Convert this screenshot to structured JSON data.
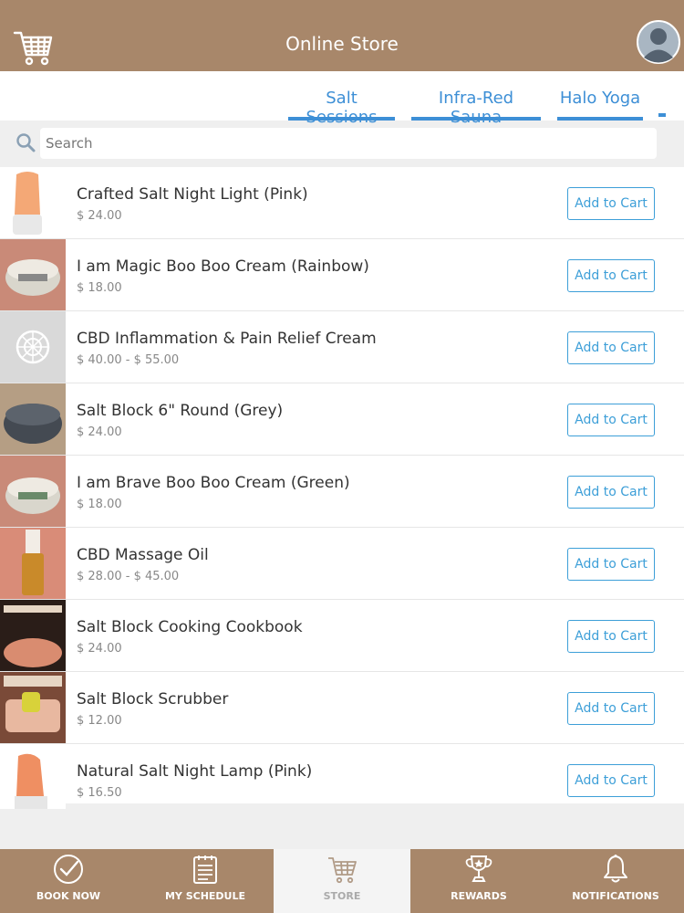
{
  "header": {
    "title": "Online Store",
    "cart_icon": "shopping-cart-icon",
    "avatar_icon": "user-avatar-icon"
  },
  "tabs": [
    {
      "label": "Salt Sessions"
    },
    {
      "label": "Infra-Red Sauna"
    },
    {
      "label": "Halo Yoga"
    }
  ],
  "search": {
    "placeholder": "Search",
    "icon": "search-icon"
  },
  "add_label": "Add to Cart",
  "products": [
    {
      "name": "Crafted Salt Night Light (Pink)",
      "price": "$ 24.00"
    },
    {
      "name": "I am Magic Boo Boo Cream (Rainbow)",
      "price": "$ 18.00"
    },
    {
      "name": "CBD Inflammation & Pain Relief Cream",
      "price": "$ 40.00 - $ 55.00"
    },
    {
      "name": "Salt Block 6\" Round (Grey)",
      "price": "$ 24.00"
    },
    {
      "name": "I am Brave Boo Boo Cream (Green)",
      "price": "$ 18.00"
    },
    {
      "name": "CBD Massage Oil",
      "price": "$ 28.00 - $ 45.00"
    },
    {
      "name": "Salt Block Cooking Cookbook",
      "price": "$ 24.00"
    },
    {
      "name": "Salt Block Scrubber",
      "price": "$ 12.00"
    },
    {
      "name": "Natural Salt Night Lamp (Pink)",
      "price": "$ 16.50"
    }
  ],
  "nav": [
    {
      "label": "BOOK NOW",
      "icon": "check-circle-icon"
    },
    {
      "label": "MY SCHEDULE",
      "icon": "calendar-icon"
    },
    {
      "label": "STORE",
      "icon": "shopping-cart-icon"
    },
    {
      "label": "REWARDS",
      "icon": "trophy-icon"
    },
    {
      "label": "NOTIFICATIONS",
      "icon": "bell-icon"
    }
  ],
  "colors": {
    "brand": "#a8876a",
    "accent": "#3d8fd6",
    "button": "#3d9fd8"
  }
}
